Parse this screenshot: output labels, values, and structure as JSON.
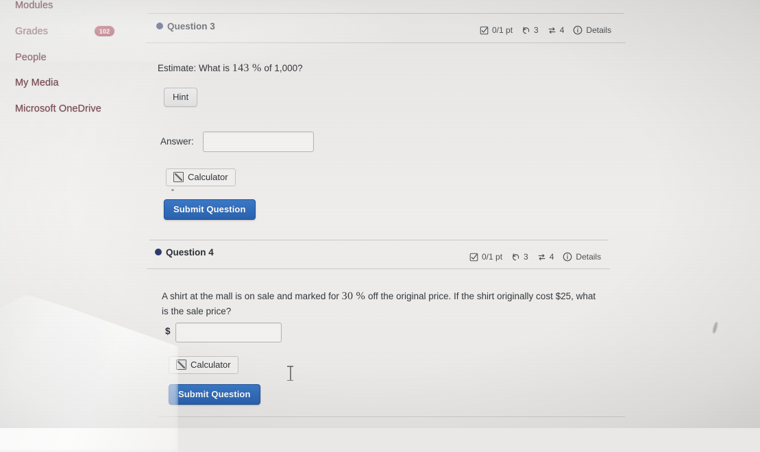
{
  "sidebar": {
    "items": [
      {
        "label": "Modules",
        "badge": null
      },
      {
        "label": "Grades",
        "badge": "102"
      },
      {
        "label": "People",
        "badge": null
      },
      {
        "label": "My Media",
        "badge": null
      },
      {
        "label": "Microsoft OneDrive",
        "badge": null
      }
    ]
  },
  "accent_colors": {
    "nav_text": "#7a4a52",
    "badge_bg": "#a63a4c",
    "question_dot": "#2d3a6b",
    "submit_button": "#2f6fc0"
  },
  "questions": [
    {
      "title": "Question 3",
      "status": {
        "points": "0/1 pt",
        "attempts_icon": "undo-icon",
        "attempts": "3",
        "shuffle_icon": "exchange-icon",
        "shuffle": "4",
        "details_icon": "info-icon",
        "details_label": "Details",
        "points_icon": "checkbox-icon"
      },
      "prompt_before": "Estimate: What is",
      "prompt_math": "143 %",
      "prompt_after": "of 1,000?",
      "hint_label": "Hint",
      "answer_label": "Answer:",
      "answer_value": "",
      "answer_placeholder": "",
      "calculator_label": "Calculator",
      "submit_label": "Submit Question"
    },
    {
      "title": "Question 4",
      "status": {
        "points": "0/1 pt",
        "attempts_icon": "undo-icon",
        "attempts": "3",
        "shuffle_icon": "exchange-icon",
        "shuffle": "4",
        "details_icon": "info-icon",
        "details_label": "Details",
        "points_icon": "checkbox-icon"
      },
      "prompt_before": "A shirt at the mall is on sale and marked for",
      "prompt_math": "30 %",
      "prompt_after": "off the original price. If the shirt originally cost $25, what is the sale price?",
      "currency_symbol": "$",
      "answer_value": "",
      "answer_placeholder": "",
      "calculator_label": "Calculator",
      "submit_label": "Submit Question"
    }
  ]
}
